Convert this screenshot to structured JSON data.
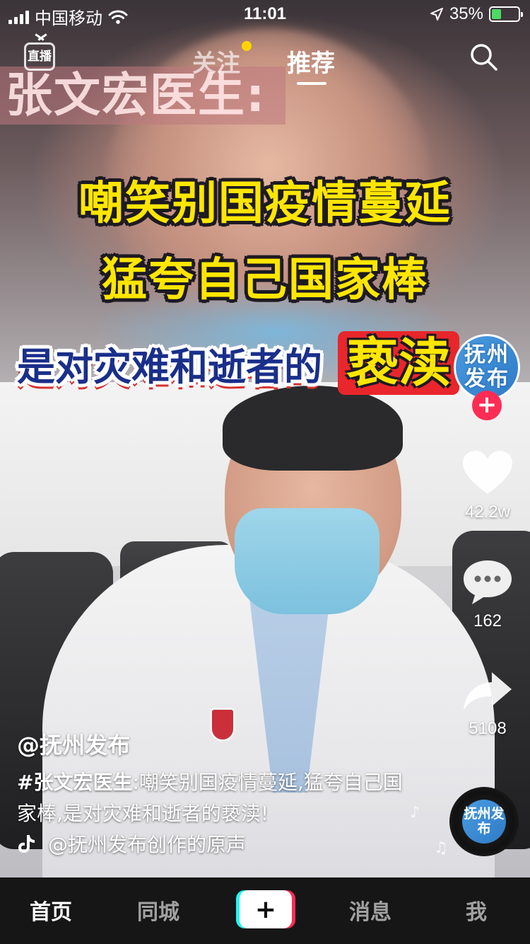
{
  "status_bar": {
    "carrier": "中国移动",
    "time": "11:01",
    "battery_percent": "35%",
    "battery_level": 0.35
  },
  "top_nav": {
    "live_label": "直播",
    "tab_follow": "关注",
    "tab_recommend": "推荐",
    "follow_has_update": true
  },
  "video": {
    "title_name": "张文宏医生:",
    "caption_line1": "嘲笑别国疫情蔓延",
    "caption_line2": "猛夸自己国家棒",
    "caption_line3_main": "是对灾难和逝者的",
    "caption_line3_highlight": "亵渎"
  },
  "actions": {
    "avatar_text": "抚州发布",
    "follow_symbol": "+",
    "likes": "42.2w",
    "comments": "162",
    "shares": "5108"
  },
  "post": {
    "author": "@抚州发布",
    "hashtag": "#张文宏医生",
    "description": ":嘲笑别国疫情蔓延,猛夸自己国家棒,是对灾难和逝者的亵渎!",
    "music": "@抚州发布创作的原声"
  },
  "tab_bar": {
    "home": "首页",
    "nearby": "同城",
    "create_symbol": "+",
    "messages": "消息",
    "me": "我"
  },
  "colors": {
    "accent_red": "#fe2c55",
    "accent_cyan": "#25f4ee",
    "caption_yellow": "#ffe600",
    "battery_green": "#4cd964"
  }
}
